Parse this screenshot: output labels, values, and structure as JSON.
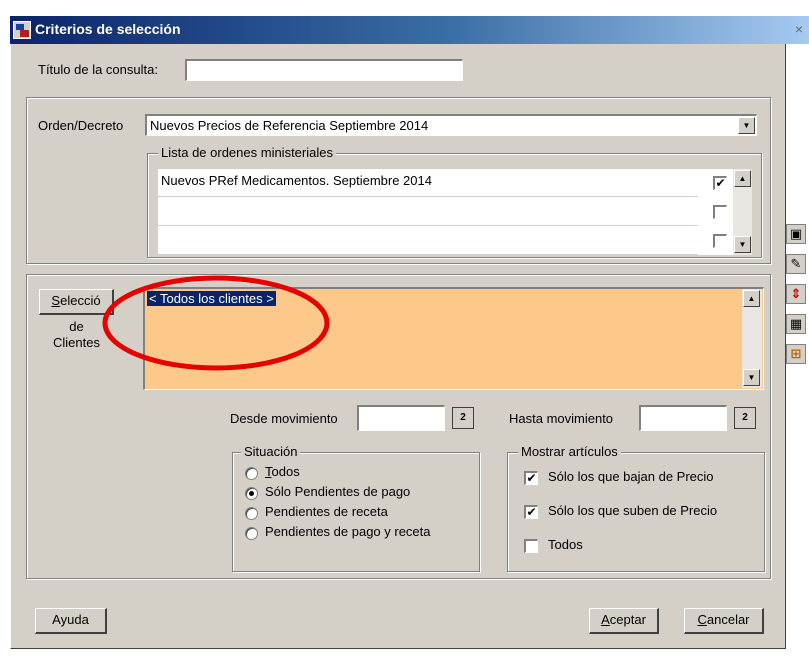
{
  "window": {
    "title": "Criterios de selección",
    "close_glyph": "×"
  },
  "consulta": {
    "label": "Título de la consulta:",
    "value": ""
  },
  "orden": {
    "label": "Orden/Decreto",
    "selected": "Nuevos Precios de Referencia Septiembre 2014"
  },
  "lista": {
    "legend": "Lista de ordenes ministeriales",
    "rows": [
      {
        "text": "Nuevos PRef Medicamentos. Septiembre 2014",
        "checked": true
      },
      {
        "text": "",
        "checked": false
      },
      {
        "text": "",
        "checked": false
      }
    ]
  },
  "clientes": {
    "button_label": "Selecció",
    "label_line1": "de",
    "label_line2": "Clientes",
    "selected_item": "< Todos los clientes >",
    "list_bg": "#fcc98a",
    "highlight_color": "#e60000"
  },
  "movimientos": {
    "desde_label": "Desde movimiento",
    "desde_value": "",
    "hasta_label": "Hasta movimiento",
    "hasta_value": ""
  },
  "situacion": {
    "legend": "Situación",
    "options": [
      {
        "label": "Todos",
        "selected": false
      },
      {
        "label": "Sólo Pendientes de pago",
        "selected": true
      },
      {
        "label": "Pendientes de receta",
        "selected": false
      },
      {
        "label": "Pendientes de pago y receta",
        "selected": false
      }
    ]
  },
  "mostrar": {
    "legend": "Mostrar artículos",
    "options": [
      {
        "label": "Sólo los que bajan de Precio",
        "checked": true
      },
      {
        "label": "Sólo los que suben de Precio",
        "checked": true
      },
      {
        "label": "Todos",
        "checked": false
      }
    ]
  },
  "buttons": {
    "ayuda": "Ayuda",
    "aceptar": "Aceptar",
    "cancelar": "Cancelar"
  },
  "icons": {
    "check": "✔",
    "calendar": "2",
    "arrow_up": "▲",
    "arrow_down": "▼",
    "side_tools": [
      "save-icon",
      "edit-icon",
      "fit-height-icon",
      "grid-icon",
      "tree-icon"
    ],
    "side_glyphs": [
      "▣",
      "✎",
      "⇕",
      "▦",
      "⊞"
    ]
  }
}
